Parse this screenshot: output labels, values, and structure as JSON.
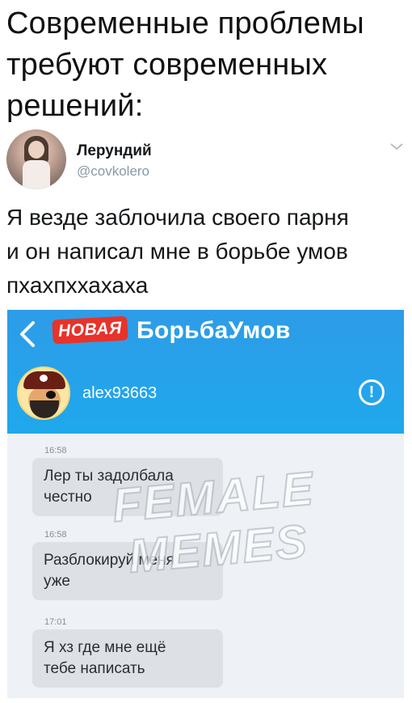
{
  "meme": {
    "caption": "Современные проблемы\nтребуют современных\nрешений:"
  },
  "tweet": {
    "author_name": "Лерундий",
    "author_handle": "@covkolero",
    "text": "Я везде заблочила своего парня\nи он написал мне в борьбе умов\nпхахпххахаха"
  },
  "app": {
    "badge": "НОВАЯ",
    "title": "БорьбаУмов",
    "header_color": "#1fa8ec",
    "badge_color": "#e8322a",
    "chat_user": "alex93663",
    "info_icon_glyph": "!"
  },
  "messages": [
    {
      "time": "16:58",
      "text": "Лер ты задолбала\nчестно"
    },
    {
      "time": "16:58",
      "text": "Разблокируй меня\nуже"
    },
    {
      "time": "17:01",
      "text": "Я хз где мне ещё\nтебе написать"
    }
  ],
  "watermark": {
    "line1": "FEMALE",
    "line2": "MEMES"
  }
}
